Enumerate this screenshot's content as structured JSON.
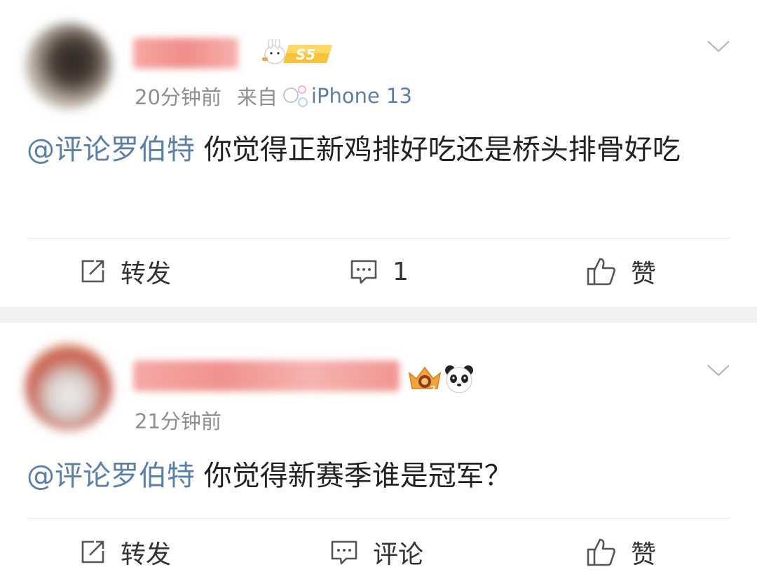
{
  "posts": [
    {
      "time": "20分钟前",
      "from_label": "来自",
      "device": "iPhone 13",
      "mention": "@评论罗伯特",
      "text": "你觉得正新鸡排好吃还是桥头排骨好吃",
      "badge": "S5",
      "actions": {
        "repost": "转发",
        "comment": "1",
        "like": "赞"
      }
    },
    {
      "time": "21分钟前",
      "mention": "@评论罗伯特",
      "text": "你觉得新赛季谁是冠军？",
      "actions": {
        "repost": "转发",
        "comment": "评论",
        "like": "赞"
      }
    }
  ],
  "icons": {
    "repost": "repost-icon",
    "comment": "comment-icon",
    "like": "thumbs-up-icon",
    "menu": "chevron-down-icon"
  },
  "colors": {
    "mention": "#5b7fa8",
    "meta": "#8f8f8f",
    "separator": "#f1f1f3",
    "dog": "#f2922a"
  }
}
